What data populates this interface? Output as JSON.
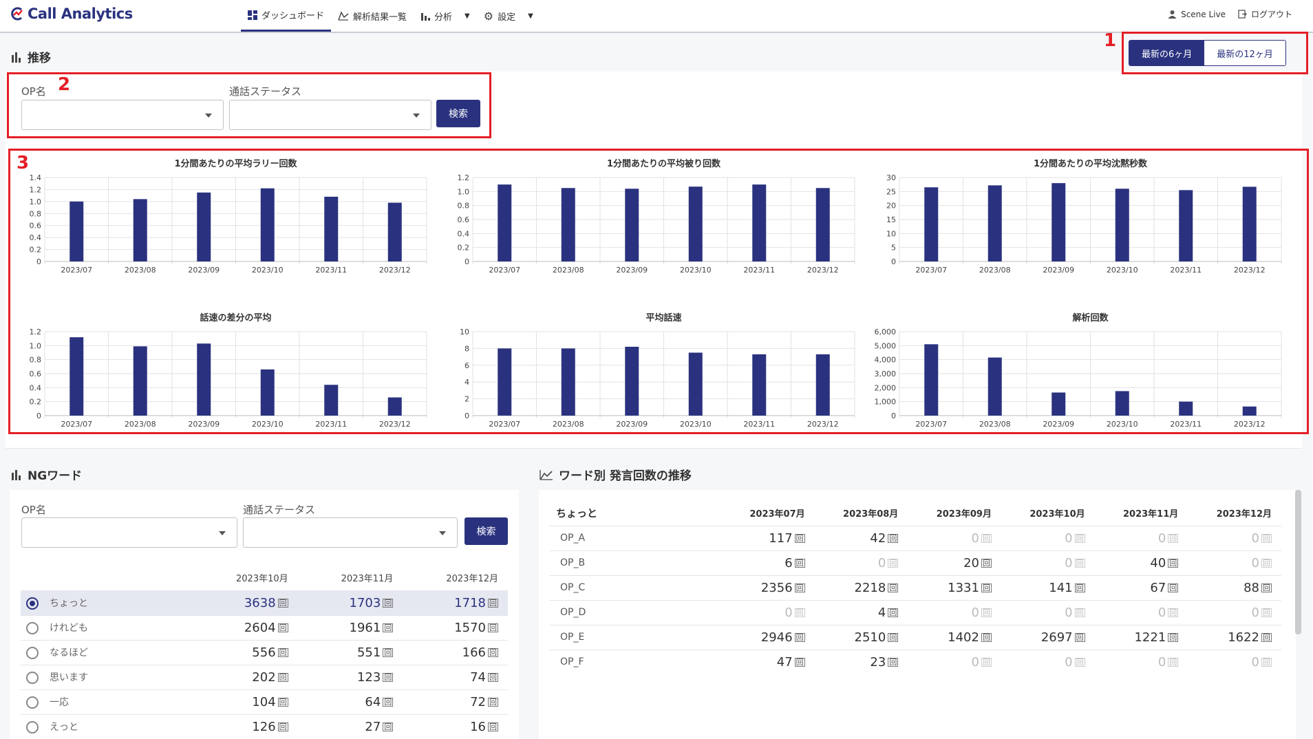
{
  "app": {
    "title": "Call Analytics"
  },
  "nav": {
    "dashboard": "ダッシュボード",
    "results": "解析結果一覧",
    "analysis": "分析",
    "settings": "設定"
  },
  "user": {
    "name": "Scene Live",
    "logout": "ログアウト"
  },
  "trend": {
    "title": "推移",
    "period_6": "最新の6ヶ月",
    "period_12": "最新の12ヶ月",
    "op_label": "OP名",
    "status_label": "通話ステータス",
    "search": "検索"
  },
  "annotations": {
    "n1": "1",
    "n2": "2",
    "n3": "3"
  },
  "colors": {
    "accent": "#2a327f",
    "annotation": "#e41e26"
  },
  "chart_data": [
    {
      "type": "bar",
      "title": "1分間あたりの平均ラリー回数",
      "categories": [
        "2023/07",
        "2023/08",
        "2023/09",
        "2023/10",
        "2023/11",
        "2023/12"
      ],
      "values": [
        1.0,
        1.04,
        1.15,
        1.22,
        1.08,
        0.98
      ],
      "ylim": [
        0,
        1.4
      ],
      "yticks": [
        "0",
        "0.2",
        "0.4",
        "0.6",
        "0.8",
        "1.0",
        "1.2",
        "1.4"
      ]
    },
    {
      "type": "bar",
      "title": "1分間あたりの平均被り回数",
      "categories": [
        "2023/07",
        "2023/08",
        "2023/09",
        "2023/10",
        "2023/11",
        "2023/12"
      ],
      "values": [
        1.1,
        1.05,
        1.04,
        1.07,
        1.1,
        1.05
      ],
      "ylim": [
        0,
        1.2
      ],
      "yticks": [
        "0",
        "0.2",
        "0.4",
        "0.6",
        "0.8",
        "1.0",
        "1.2"
      ]
    },
    {
      "type": "bar",
      "title": "1分間あたりの平均沈黙秒数",
      "categories": [
        "2023/07",
        "2023/08",
        "2023/09",
        "2023/10",
        "2023/11",
        "2023/12"
      ],
      "values": [
        26.5,
        27.2,
        28.0,
        26.0,
        25.5,
        26.7
      ],
      "ylim": [
        0,
        30
      ],
      "yticks": [
        "0",
        "5",
        "10",
        "15",
        "20",
        "25",
        "30"
      ]
    },
    {
      "type": "bar",
      "title": "話速の差分の平均",
      "categories": [
        "2023/07",
        "2023/08",
        "2023/09",
        "2023/10",
        "2023/11",
        "2023/12"
      ],
      "values": [
        1.12,
        0.99,
        1.03,
        0.66,
        0.44,
        0.26
      ],
      "ylim": [
        0,
        1.2
      ],
      "yticks": [
        "0",
        "0.2",
        "0.4",
        "0.6",
        "0.8",
        "1.0",
        "1.2"
      ]
    },
    {
      "type": "bar",
      "title": "平均話速",
      "categories": [
        "2023/07",
        "2023/08",
        "2023/09",
        "2023/10",
        "2023/11",
        "2023/12"
      ],
      "values": [
        8.0,
        8.0,
        8.2,
        7.5,
        7.3,
        7.3
      ],
      "ylim": [
        0,
        10
      ],
      "yticks": [
        "0",
        "2",
        "4",
        "6",
        "8",
        "10"
      ]
    },
    {
      "type": "bar",
      "title": "解析回数",
      "categories": [
        "2023/07",
        "2023/08",
        "2023/09",
        "2023/10",
        "2023/11",
        "2023/12"
      ],
      "values": [
        5100,
        4150,
        1650,
        1750,
        1000,
        650
      ],
      "ylim": [
        0,
        6000
      ],
      "yticks": [
        "0",
        "1,000",
        "2,000",
        "3,000",
        "4,000",
        "5,000",
        "6,000"
      ]
    }
  ],
  "ng": {
    "title": "NGワード",
    "op_label": "OP名",
    "status_label": "通話ステータス",
    "search": "検索",
    "columns": [
      "2023年10月",
      "2023年11月",
      "2023年12月"
    ],
    "unit": "回",
    "rows": [
      {
        "word": "ちょっと",
        "values": [
          3638,
          1703,
          1718
        ],
        "selected": true
      },
      {
        "word": "けれども",
        "values": [
          2604,
          1961,
          1570
        ]
      },
      {
        "word": "なるほど",
        "values": [
          556,
          551,
          166
        ]
      },
      {
        "word": "思います",
        "values": [
          202,
          123,
          74
        ]
      },
      {
        "word": "一応",
        "values": [
          104,
          64,
          72
        ]
      },
      {
        "word": "えっと",
        "values": [
          126,
          27,
          16
        ]
      }
    ]
  },
  "word_trend": {
    "title": "ワード別 発言回数の推移",
    "word": "ちょっと",
    "columns": [
      "2023年07月",
      "2023年08月",
      "2023年09月",
      "2023年10月",
      "2023年11月",
      "2023年12月"
    ],
    "unit": "回",
    "rows": [
      {
        "op": "OP_A",
        "values": [
          117,
          42,
          0,
          0,
          0,
          0
        ]
      },
      {
        "op": "OP_B",
        "values": [
          6,
          0,
          20,
          0,
          40,
          0
        ]
      },
      {
        "op": "OP_C",
        "values": [
          2356,
          2218,
          1331,
          141,
          67,
          88
        ]
      },
      {
        "op": "OP_D",
        "values": [
          0,
          4,
          0,
          0,
          0,
          0
        ]
      },
      {
        "op": "OP_E",
        "values": [
          2946,
          2510,
          1402,
          2697,
          1221,
          1622
        ]
      },
      {
        "op": "OP_F",
        "values": [
          47,
          23,
          0,
          0,
          0,
          0
        ]
      }
    ]
  }
}
